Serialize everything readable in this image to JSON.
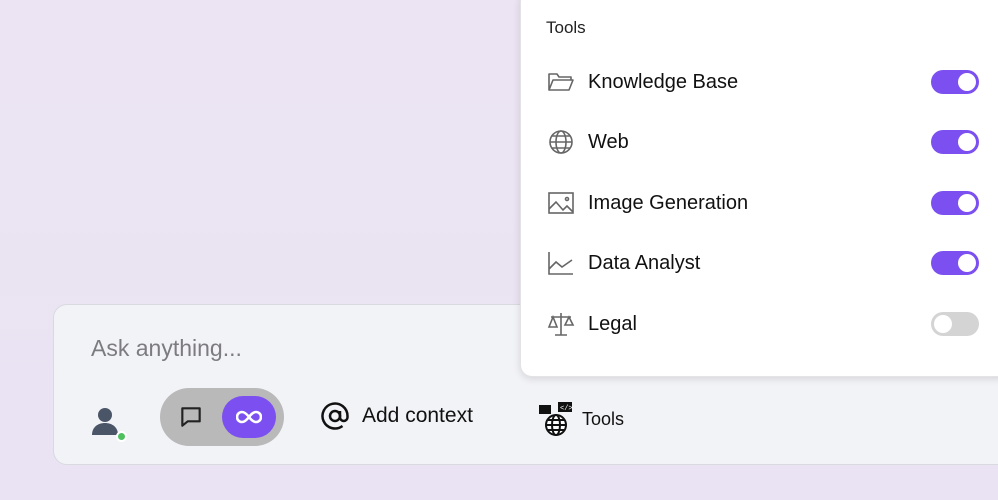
{
  "composer": {
    "placeholder": "Ask anything...",
    "add_context_label": "Add context",
    "tools_label": "Tools"
  },
  "accent": "#7b4ff0",
  "panel": {
    "title": "Tools",
    "items": [
      {
        "label": "Knowledge Base",
        "icon": "folder-icon",
        "enabled": true
      },
      {
        "label": "Web",
        "icon": "globe-icon",
        "enabled": true
      },
      {
        "label": "Image Generation",
        "icon": "image-icon",
        "enabled": true
      },
      {
        "label": "Data Analyst",
        "icon": "line-chart-icon",
        "enabled": true
      },
      {
        "label": "Legal",
        "icon": "scale-icon",
        "enabled": false
      }
    ]
  }
}
